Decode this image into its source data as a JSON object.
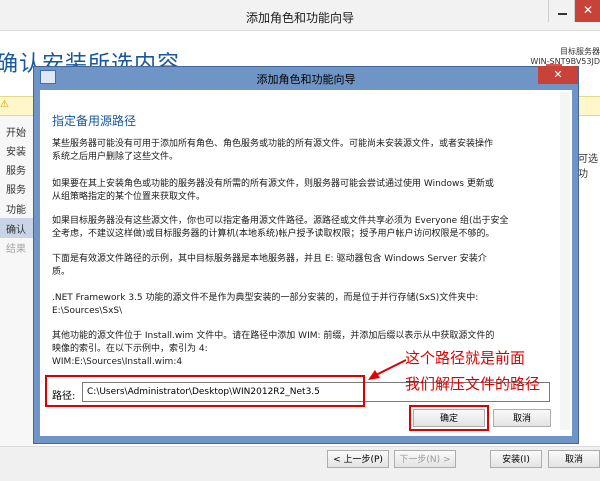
{
  "background": {
    "window_title": "添加角色和功能向导",
    "page_title": "确认安装所选内容",
    "server_label": "目标服务器",
    "server_name": "WIN-SNT9BV53JD",
    "nav_items": [
      "开始",
      "安装",
      "服务",
      "服务",
      "功能",
      "确认",
      "结果"
    ],
    "right_cut_text": "可选功",
    "footer": {
      "prev_label": "< 上一步(P)",
      "next_label": "下一步(N) >",
      "install_label": "安装(I)",
      "cancel_label": "取消"
    }
  },
  "dialog": {
    "title": "添加角色和功能向导",
    "section_title": "指定备用源路径",
    "paragraphs": [
      "某些服务器可能没有可用于添加所有角色、角色服务或功能的所有源文件。可能尚未安装源文件，或者安装操作\n系统之后用户删除了这些文件。",
      "如果要在其上安装角色或功能的服务器没有所需的所有源文件，则服务器可能会尝试通过使用 Windows 更新或\n从组策略指定的某个位置来获取文件。",
      "如果目标服务器没有这些源文件，你也可以指定备用源文件路径。源路径或文件共享必须为 Everyone 组(出于安全\n全考虑，不建议这样做)或目标服务器的计算机(本地系统)帐户授予读取权限；授予用户帐户访问权限是不够的。",
      "下面是有效源文件路径的示例，其中目标服务器是本地服务器，并且 E: 驱动器包含 Windows Server 安装介\n质。",
      ".NET Framework 3.5 功能的源文件不是作为典型安装的一部分安装的，而是位于并行存储(SxS)文件夹中:\n        E:\\Sources\\SxS\\",
      "其他功能的源文件位于 Install.wim 文件中。请在路径中添加 WIM: 前缀，并添加后缀以表示从中获取源文件的\n映像的索引。在以下示例中，索引为 4:\n        WIM:E:\\Sources\\Install.wim:4"
    ],
    "path_label": "路径:",
    "path_value": "C:\\Users\\Administrator\\Desktop\\WIN2012R2_Net3.5",
    "ok_label": "确定",
    "cancel_label": "取消"
  },
  "annotation": {
    "line1": "这个路径就是前面",
    "line2": "我们解压文件的路径"
  },
  "colors": {
    "accent_blue": "#17579e",
    "annotation_red": "#e00000",
    "dialog_frame": "#6e95c5"
  }
}
